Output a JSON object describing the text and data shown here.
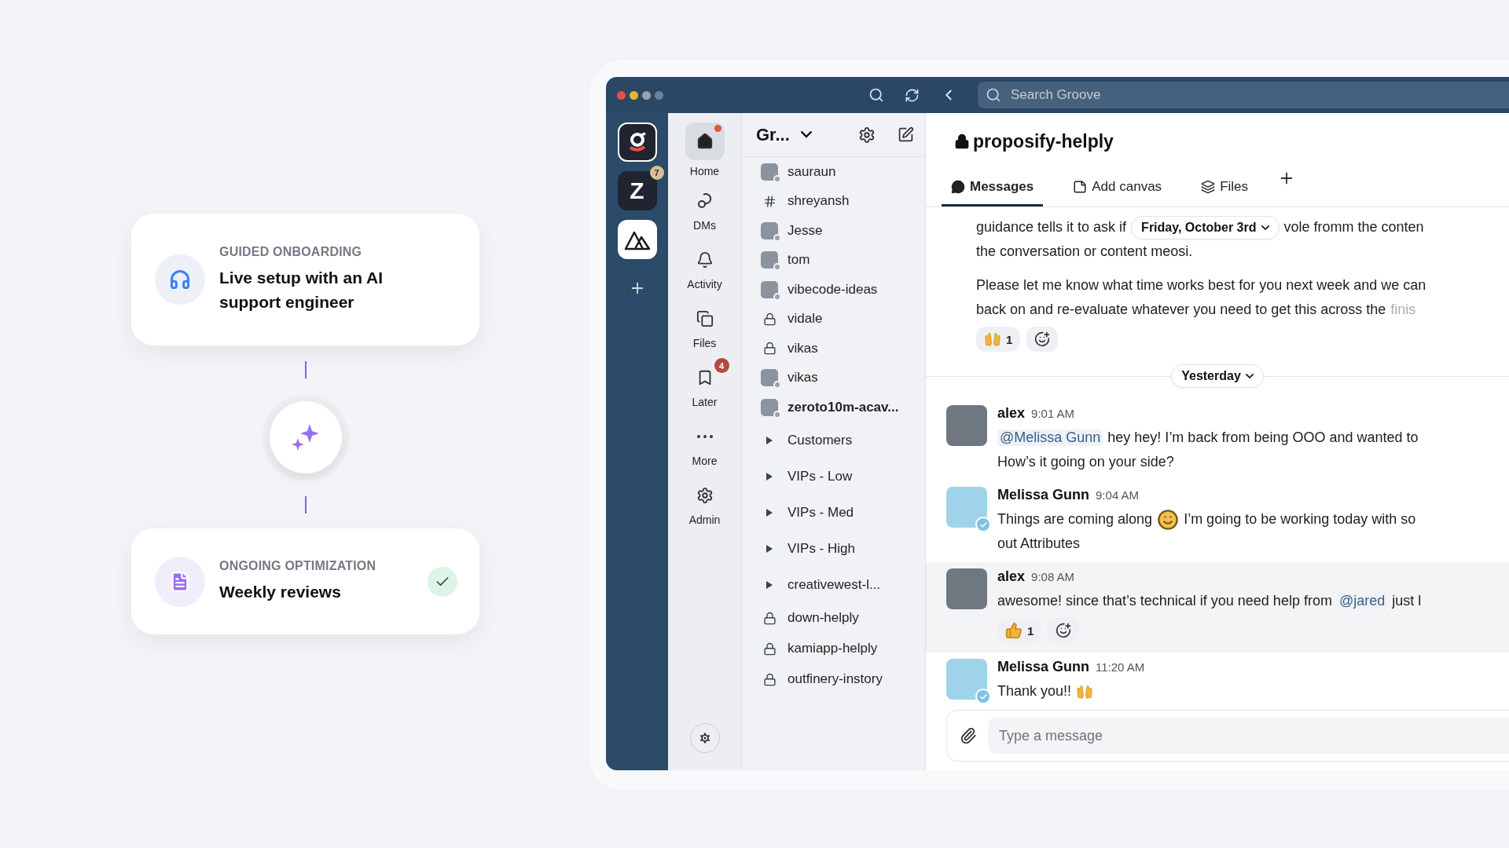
{
  "steps": [
    {
      "kind": "headset",
      "eyebrow": "GUIDED ONBOARDING",
      "title": "Live setup with an AI support engineer",
      "done": false
    },
    {
      "kind": "notes",
      "eyebrow": "ONGOING OPTIMIZATION",
      "title": "Weekly reviews",
      "done": true
    }
  ],
  "window": {
    "search_placeholder": "Search Groove"
  },
  "workspaces": [
    {
      "kind": "logo",
      "selected": true
    },
    {
      "kind": "letter",
      "letter": "Z",
      "badge": "7",
      "selected": false
    },
    {
      "kind": "mountain",
      "selected": false
    }
  ],
  "nav": [
    {
      "label": "Home",
      "selected": true,
      "dot": true
    },
    {
      "label": "DMs",
      "selected": false,
      "dot": false
    },
    {
      "label": "Activity",
      "selected": false,
      "dot": false
    },
    {
      "label": "Files",
      "selected": false,
      "dot": false
    },
    {
      "label": "Later",
      "selected": false,
      "dot": false,
      "badge": "4"
    },
    {
      "label": "More",
      "selected": false,
      "dot": false
    },
    {
      "label": "Admin",
      "selected": false,
      "dot": false
    }
  ],
  "sidebar": {
    "workspace_name": "Gr...",
    "channels": [
      {
        "kind": "avatar",
        "name": "sauraun",
        "unread": false
      },
      {
        "kind": "hash",
        "name": "shreyansh",
        "unread": false
      },
      {
        "kind": "avatar",
        "name": "Jesse",
        "unread": false
      },
      {
        "kind": "avatar",
        "name": "tom",
        "unread": false
      },
      {
        "kind": "avatar",
        "name": "vibecode-ideas",
        "unread": false
      },
      {
        "kind": "lock",
        "name": "vidale",
        "unread": false
      },
      {
        "kind": "lock",
        "name": "vikas",
        "unread": false
      },
      {
        "kind": "avatar",
        "name": "vikas",
        "unread": false
      },
      {
        "kind": "avatar",
        "name": "zeroto10m-acav...",
        "unread": true
      },
      {
        "kind": "group",
        "name": "Customers",
        "unread": false
      },
      {
        "kind": "group",
        "name": "VIPs - Low",
        "unread": false
      },
      {
        "kind": "group",
        "name": "VIPs - Med",
        "unread": false
      },
      {
        "kind": "group",
        "name": "VIPs - High",
        "unread": false
      },
      {
        "kind": "group",
        "name": "creativewest-l...",
        "unread": false
      },
      {
        "kind": "lock",
        "name": "down-helply",
        "unread": false
      },
      {
        "kind": "lock",
        "name": "kamiapp-helply",
        "unread": false
      },
      {
        "kind": "lock",
        "name": "outfinery-instory",
        "unread": false
      }
    ]
  },
  "channel": {
    "name": "proposify-helply",
    "private": true,
    "tabs": [
      {
        "label": "Messages",
        "selected": true
      },
      {
        "label": "Add canvas",
        "selected": false
      },
      {
        "label": "Files",
        "selected": false
      }
    ]
  },
  "earlier": {
    "line1_start": "guidance tells it to ask if",
    "date_pill": "Friday, October 3rd",
    "line1_end": "vole fromm the conten",
    "lines": [
      "the conversation or content meosi."
    ],
    "para2": [
      "Please let me know what time works best for you next week and we can",
      "back on and re-evaluate whatever you need to get this across the"
    ],
    "para2_faded": "finis",
    "reactions": [
      {
        "kind": "hands",
        "count": "1"
      }
    ]
  },
  "divider": "Yesterday",
  "messages": [
    {
      "author": "alex",
      "time": "9:01 AM",
      "verified": false,
      "highlighted": false,
      "lines": [
        [
          {
            "kind": "mention",
            "text": "@Melissa Gunn"
          },
          {
            "kind": "text",
            "text": "hey hey! I’m back from being OOO and wanted to"
          }
        ],
        [
          {
            "kind": "text",
            "text": "How’s it going on your side?"
          }
        ]
      ]
    },
    {
      "author": "Melissa Gunn",
      "time": "9:04 AM",
      "verified": true,
      "highlighted": false,
      "lines": [
        [
          {
            "kind": "text",
            "text": "Things are coming along"
          },
          {
            "kind": "smiley"
          },
          {
            "kind": "text",
            "text": "I’m going to be working today with so"
          }
        ],
        [
          {
            "kind": "text",
            "text": "out Attributes"
          }
        ]
      ]
    },
    {
      "author": "alex",
      "time": "9:08 AM",
      "verified": false,
      "highlighted": true,
      "lines": [
        [
          {
            "kind": "text",
            "text": "awesome! since that’s technical if you need help from"
          },
          {
            "kind": "mention",
            "text": "@jared"
          },
          {
            "kind": "text",
            "text": "just l"
          }
        ]
      ],
      "reactions": [
        {
          "kind": "thumbs",
          "count": "1"
        }
      ]
    },
    {
      "author": "Melissa Gunn",
      "time": "11:20 AM",
      "verified": true,
      "highlighted": false,
      "lines": [
        [
          {
            "kind": "text",
            "text": "Thank you!!"
          },
          {
            "kind": "hands"
          }
        ]
      ]
    }
  ],
  "composer": {
    "placeholder": "Type a message"
  }
}
